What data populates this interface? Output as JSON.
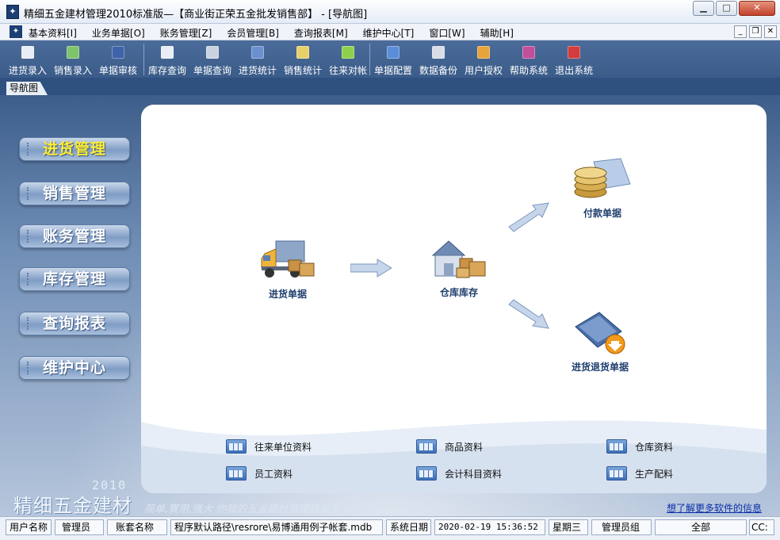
{
  "window": {
    "title": "精细五金建材管理2010标准版—【商业街正荣五金批发销售部】 - [导航图]",
    "app_icon": "app-logo-icon",
    "controls": [
      "minimize",
      "maximize",
      "close"
    ]
  },
  "menu": {
    "items": [
      "基本资料[I]",
      "业务单据[O]",
      "账务管理[Z]",
      "会员管理[B]",
      "查询报表[M]",
      "维护中心[T]",
      "窗口[W]",
      "辅助[H]"
    ]
  },
  "toolbar": {
    "groups": [
      [
        {
          "label": "进货录入",
          "icon": "purchase-entry-icon",
          "color": "#e9eef6"
        },
        {
          "label": "销售录入",
          "icon": "sales-entry-icon",
          "color": "#7fc36a"
        },
        {
          "label": "单据审核",
          "icon": "audit-check-icon",
          "color": "#3e63a8"
        }
      ],
      [
        {
          "label": "库存查询",
          "icon": "inventory-search-icon",
          "color": "#e9eef6"
        },
        {
          "label": "单据查询",
          "icon": "doc-search-icon",
          "color": "#c9d3df"
        },
        {
          "label": "进货统计",
          "icon": "purchase-stats-icon",
          "color": "#6c8fd0"
        },
        {
          "label": "销售统计",
          "icon": "sales-stats-icon",
          "color": "#e7d06a"
        },
        {
          "label": "往来对帐",
          "icon": "account-reconcile-icon",
          "color": "#8ed04c"
        }
      ],
      [
        {
          "label": "单据配置",
          "icon": "doc-config-icon",
          "color": "#5b8ed8"
        },
        {
          "label": "数据备份",
          "icon": "backup-icon",
          "color": "#d8dde6"
        },
        {
          "label": "用户授权",
          "icon": "user-auth-icon",
          "color": "#e7a43c"
        },
        {
          "label": "帮助系统",
          "icon": "help-icon",
          "color": "#c14f9a"
        },
        {
          "label": "退出系统",
          "icon": "exit-icon",
          "color": "#d23c3c"
        }
      ]
    ]
  },
  "tab": {
    "label": "导航图"
  },
  "nav": {
    "items": [
      {
        "label": "进货管理",
        "active": true
      },
      {
        "label": "销售管理",
        "active": false
      },
      {
        "label": "账务管理",
        "active": false
      },
      {
        "label": "库存管理",
        "active": false
      },
      {
        "label": "查询报表",
        "active": false
      },
      {
        "label": "维护中心",
        "active": false
      }
    ]
  },
  "flow": {
    "purchase_doc": "进货单据",
    "warehouse_stock": "仓库库存",
    "payment_doc": "付款单据",
    "purchase_return_doc": "进货退货单据"
  },
  "quick_links": [
    "往来单位资料",
    "商品资料",
    "仓库资料",
    "员工资料",
    "会计科目资料",
    "生产配料"
  ],
  "branding": {
    "year": "2010",
    "product": "精细五金建材",
    "slogan": "简单,實用,強大 你我的五金建材管理好幫手",
    "more_link": "想了解更多软件的信息"
  },
  "status": {
    "user_label": "用户名称",
    "user_value": "管理员",
    "account_label": "账套名称",
    "path_value": "程序默认路径\\resrore\\易博通用例子帐套.mdb",
    "date_label": "系统日期",
    "datetime_value": "2020-02-19  15:36:52",
    "weekday": "星期三",
    "group_value": "管理员组",
    "scope_value": "全部",
    "mode_value": "CC:"
  }
}
